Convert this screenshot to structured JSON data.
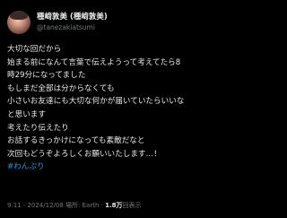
{
  "author": {
    "display_name": "種﨑敦美 (種﨑敦美)",
    "handle": "@tanezakiatsumi"
  },
  "post": {
    "lines": [
      "大切な回だから",
      "始まる前になんて言葉で伝えようって考えてたら8",
      "時29分になってました",
      "もしまだ全部は分からなくても",
      "小さいお友達にも大切な何かが届いていたらいいな",
      "と思います",
      "考えたり伝えたり",
      "お話するきっかけになっても素敵だなと",
      "次回もどうぞよろしくお願いいたします…！"
    ],
    "hashtag": "#わんぷり"
  },
  "meta": {
    "time": "9:11",
    "date": "2024/12/08",
    "location": "場所: Earth",
    "views": "1.8万",
    "views_label": "回表示"
  }
}
